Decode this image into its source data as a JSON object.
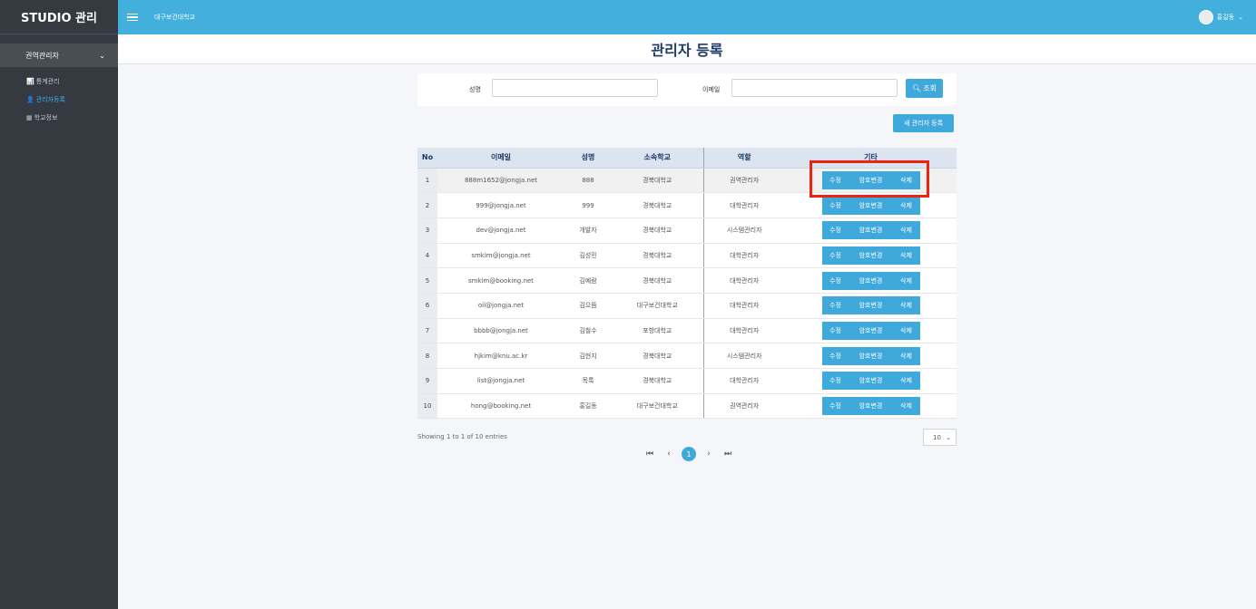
{
  "sidebar": {
    "brand": "STUDIO 관리",
    "menu_head": "권역관리자",
    "items": [
      {
        "icon": "chart-icon",
        "glyph": "📊",
        "label": "통계관리"
      },
      {
        "icon": "user-icon",
        "glyph": "👤",
        "label": "관리자등록"
      },
      {
        "icon": "school-icon",
        "glyph": "▦",
        "label": "학교정보"
      }
    ]
  },
  "topbar": {
    "title": "대구보건대학교",
    "user_name": "홍길동"
  },
  "page": {
    "title": "관리자 등록"
  },
  "search": {
    "name_label": "성명",
    "email_label": "이메일",
    "button_label": "조회",
    "name_placeholder": "",
    "email_placeholder": ""
  },
  "new_button_label": "새 관리자 등록",
  "table": {
    "columns": [
      "No",
      "이메일",
      "성명",
      "소속학교",
      "역할",
      "기타"
    ],
    "rows": [
      {
        "no": "1",
        "email": "888m1652@jongja.net",
        "name": "888",
        "school": "경북대학교",
        "role": "권역관리자"
      },
      {
        "no": "2",
        "email": "999@jongja.net",
        "name": "999",
        "school": "경북대학교",
        "role": "대학관리자"
      },
      {
        "no": "3",
        "email": "dev@jongja.net",
        "name": "개발자",
        "school": "경북대학교",
        "role": "시스템관리자"
      },
      {
        "no": "4",
        "email": "smkim@jongja.net",
        "name": "김성민",
        "school": "경북대학교",
        "role": "대학관리자"
      },
      {
        "no": "5",
        "email": "smkim@booking.net",
        "name": "김예람",
        "school": "경북대학교",
        "role": "대학관리자"
      },
      {
        "no": "6",
        "email": "oil@jongja.net",
        "name": "김으뜸",
        "school": "대구보건대학교",
        "role": "대학관리자"
      },
      {
        "no": "7",
        "email": "bbbb@jongja.net",
        "name": "김철수",
        "school": "포항대학교",
        "role": "대학관리자"
      },
      {
        "no": "8",
        "email": "hjkim@knu.ac.kr",
        "name": "김현지",
        "school": "경북대학교",
        "role": "시스템관리자"
      },
      {
        "no": "9",
        "email": "list@jongja.net",
        "name": "목록",
        "school": "경북대학교",
        "role": "대학관리자"
      },
      {
        "no": "10",
        "email": "hong@booking.net",
        "name": "홍길동",
        "school": "대구보건대학교",
        "role": "권역관리자"
      }
    ],
    "actions": {
      "edit": "수정",
      "password": "암호변경",
      "delete": "삭제"
    }
  },
  "footer": {
    "info": "Showing 1 to 1 of 10 entries",
    "current_page": "1",
    "page_size": "10"
  }
}
